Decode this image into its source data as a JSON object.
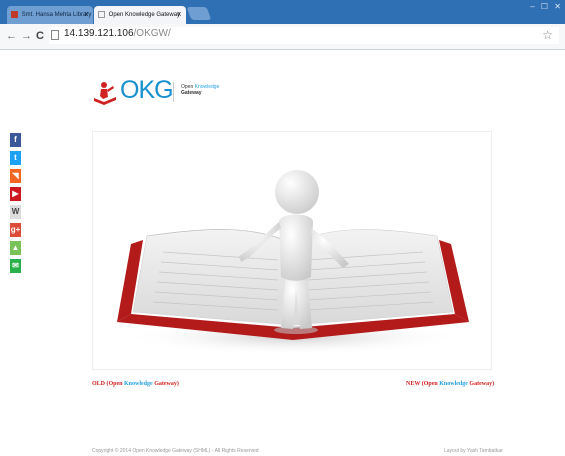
{
  "browser": {
    "tabs": [
      {
        "label": "Smt. Hansa Mehta Library",
        "close": "x"
      },
      {
        "label": "Open Knowledge Gateway",
        "close": "x"
      }
    ],
    "window_controls": "– ☐ ✕",
    "url_host": "14.139.121.106",
    "url_path": "/OKGW/"
  },
  "social": [
    {
      "icon": "facebook-icon",
      "glyph": "f",
      "color": "#3b5998"
    },
    {
      "icon": "twitter-icon",
      "glyph": "t",
      "color": "#1da1f2"
    },
    {
      "icon": "rss-icon",
      "glyph": "◥",
      "color": "#f26522"
    },
    {
      "icon": "youtube-icon",
      "glyph": "▶",
      "color": "#cc181e"
    },
    {
      "icon": "wikipedia-icon",
      "glyph": "W",
      "color": "#dddddd"
    },
    {
      "icon": "google-plus-icon",
      "glyph": "g+",
      "color": "#dd4b39"
    },
    {
      "icon": "android-icon",
      "glyph": "▲",
      "color": "#78c257"
    },
    {
      "icon": "mail-icon",
      "glyph": "✉",
      "color": "#2ab04a"
    }
  ],
  "header": {
    "logo_text": "OKG",
    "tagline_open": "Open",
    "tagline_knowledge": "Knowledge",
    "tagline_gateway": "Gateway"
  },
  "links": {
    "old_prefix": "OLD (Open",
    "old_k": "Knowledge",
    "old_suffix": "Gateway)",
    "new_prefix": "NEW (Open",
    "new_k": "Knowledge",
    "new_suffix": "Gateway)"
  },
  "footer": {
    "copyright": "Copyright © 2014 Open Knowledge Gateway (SHML) - All Rights Reserved",
    "credit": "Layout by Yash Tambatkar"
  },
  "colors": {
    "brand_blue": "#1790cf",
    "link_red": "#d21f1f"
  }
}
